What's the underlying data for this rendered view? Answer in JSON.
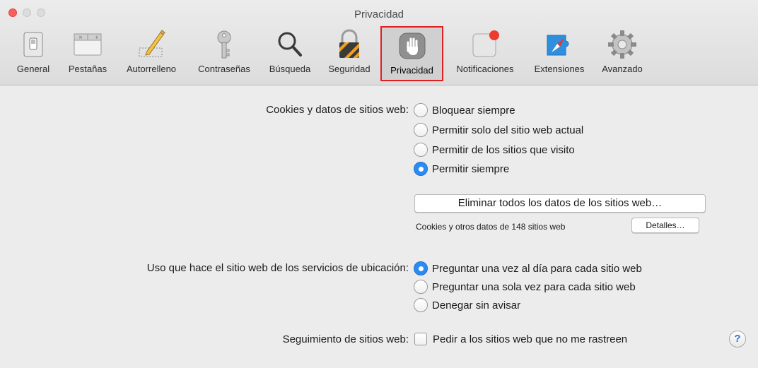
{
  "window": {
    "title": "Privacidad"
  },
  "toolbar": {
    "tabs": [
      {
        "label": "General",
        "icon": "general-switch-icon"
      },
      {
        "label": "Pestañas",
        "icon": "tabs-icon"
      },
      {
        "label": "Autorrelleno",
        "icon": "pencil-icon"
      },
      {
        "label": "Contraseñas",
        "icon": "key-icon"
      },
      {
        "label": "Búsqueda",
        "icon": "magnifier-icon"
      },
      {
        "label": "Seguridad",
        "icon": "lock-icon"
      },
      {
        "label": "Privacidad",
        "icon": "hand-icon",
        "selected": true
      },
      {
        "label": "Notificaciones",
        "icon": "notification-icon"
      },
      {
        "label": "Extensiones",
        "icon": "puzzle-compass-icon"
      },
      {
        "label": "Avanzado",
        "icon": "gear-icon"
      }
    ]
  },
  "cookies": {
    "label": "Cookies y datos de sitios web:",
    "options": [
      {
        "label": "Bloquear siempre",
        "selected": false
      },
      {
        "label": "Permitir solo del sitio web actual",
        "selected": false
      },
      {
        "label": "Permitir de los sitios que visito",
        "selected": false
      },
      {
        "label": "Permitir siempre",
        "selected": true
      }
    ],
    "remove_button": "Eliminar todos los datos de los sitios web…",
    "summary": "Cookies y otros datos de 148 sitios web",
    "details_button": "Detalles…"
  },
  "location": {
    "label": "Uso que hace el sitio web de los servicios de ubicación:",
    "options": [
      {
        "label": "Preguntar una vez al día para cada sitio web",
        "selected": true
      },
      {
        "label": "Preguntar una sola vez para cada sitio web",
        "selected": false
      },
      {
        "label": "Denegar sin avisar",
        "selected": false
      }
    ]
  },
  "tracking": {
    "label": "Seguimiento de sitios web:",
    "checkbox_label": "Pedir a los sitios web que no me rastreen",
    "checked": false
  },
  "help": {
    "label": "?"
  },
  "colors": {
    "accent": "#2b8bf2",
    "selection_border": "#e02020",
    "close_button": "#fc605c"
  }
}
